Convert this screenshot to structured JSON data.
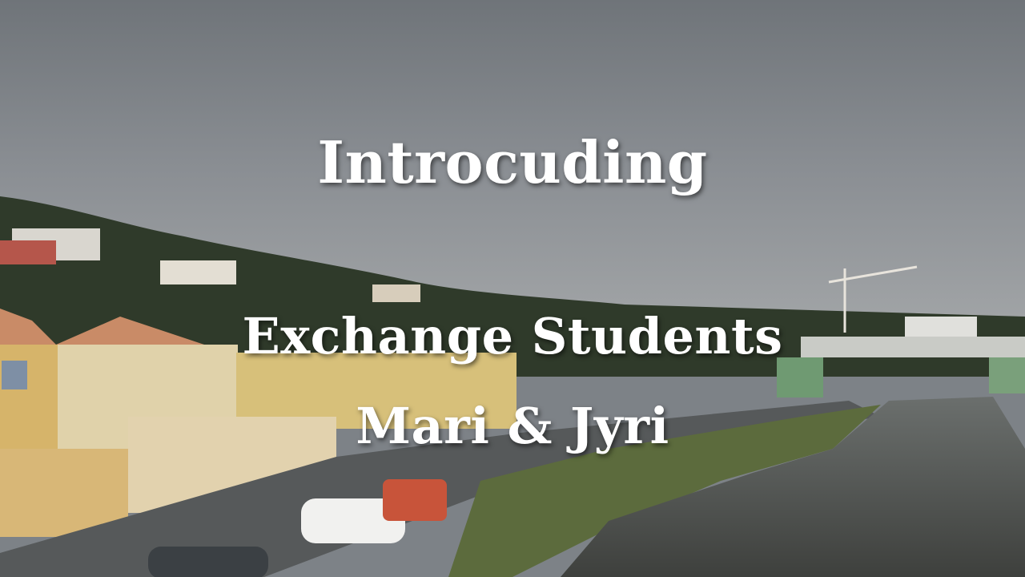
{
  "overlay": {
    "line1": "Introcuding",
    "line2": "Exchange Students",
    "line3": "Mari & Jyri"
  },
  "colors": {
    "sky": "#8a8e93",
    "hill": "#2f3a2a",
    "water": "#4d4f4c",
    "text": "#ffffff"
  }
}
